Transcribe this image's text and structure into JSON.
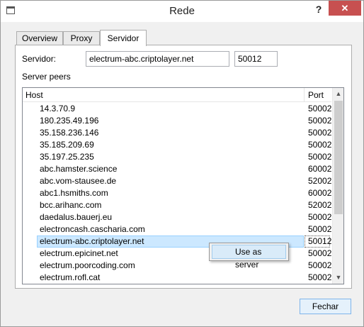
{
  "window": {
    "title": "Rede",
    "help_label": "?",
    "close_label": "✕"
  },
  "tabs": [
    {
      "label": "Overview"
    },
    {
      "label": "Proxy"
    },
    {
      "label": "Servidor"
    }
  ],
  "server": {
    "label": "Servidor:",
    "host": "electrum-abc.criptolayer.net",
    "port": "50012"
  },
  "peers": {
    "label": "Server peers",
    "columns": {
      "host": "Host",
      "port": "Port"
    },
    "rows": [
      {
        "host": "14.3.70.9",
        "port": "50002"
      },
      {
        "host": "180.235.49.196",
        "port": "50002"
      },
      {
        "host": "35.158.236.146",
        "port": "50002"
      },
      {
        "host": "35.185.209.69",
        "port": "50002"
      },
      {
        "host": "35.197.25.235",
        "port": "50002"
      },
      {
        "host": "abc.hamster.science",
        "port": "60002"
      },
      {
        "host": "abc.vom-stausee.de",
        "port": "52002"
      },
      {
        "host": "abc1.hsmiths.com",
        "port": "60002"
      },
      {
        "host": "bcc.arihanc.com",
        "port": "52002"
      },
      {
        "host": "daedalus.bauerj.eu",
        "port": "50002"
      },
      {
        "host": "electroncash.cascharia.com",
        "port": "50002"
      },
      {
        "host": "electrum-abc.criptolayer.net",
        "port": "50012"
      },
      {
        "host": "electrum.epicinet.net",
        "port": "50002"
      },
      {
        "host": "electrum.poorcoding.com",
        "port": "50002"
      },
      {
        "host": "electrum.rofl.cat",
        "port": "50002"
      }
    ],
    "selected_index": 11
  },
  "context_menu": {
    "use_as_server": "Use as server"
  },
  "footer": {
    "close_label": "Fechar"
  },
  "icons": {
    "app": "app-window-icon",
    "scroll_up": "chevron-up-icon",
    "scroll_down": "chevron-down-icon"
  },
  "colors": {
    "close_button": "#c75050",
    "selection": "#cce8ff",
    "menu_highlight": "#d9ebf9"
  }
}
